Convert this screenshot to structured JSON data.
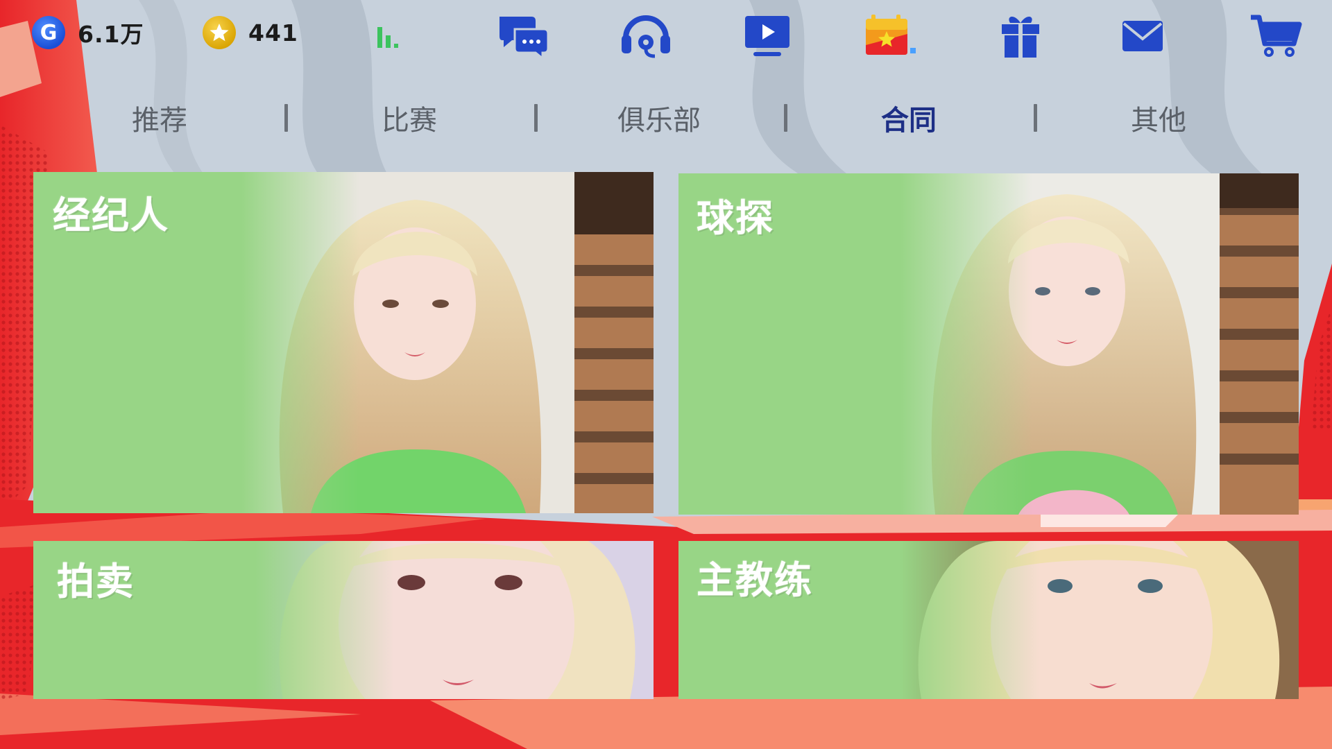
{
  "currencies": [
    {
      "icon": "g-coin-icon",
      "amount": "6.1万"
    },
    {
      "icon": "star-coin-icon",
      "amount": "441"
    }
  ],
  "toolbar_icons": [
    "signal-icon",
    "chat-icon",
    "headset-icon",
    "video-icon",
    "calendar-icon",
    "gift-icon",
    "mail-icon",
    "cart-icon"
  ],
  "tabs": [
    {
      "label": "推荐",
      "active": false
    },
    {
      "label": "比赛",
      "active": false
    },
    {
      "label": "俱乐部",
      "active": false
    },
    {
      "label": "合同",
      "active": true
    },
    {
      "label": "其他",
      "active": false
    }
  ],
  "cards": [
    {
      "title": "经纪人"
    },
    {
      "title": "球探"
    },
    {
      "title": "拍卖"
    },
    {
      "title": "主教练"
    }
  ],
  "colors": {
    "card_green": "#98d586",
    "active_tab": "#1d2f86",
    "inactive_tab": "#5a6068",
    "icon_blue": "#2348c8",
    "background_red": "#e8262a",
    "background_grey": "#c7d1dc"
  }
}
